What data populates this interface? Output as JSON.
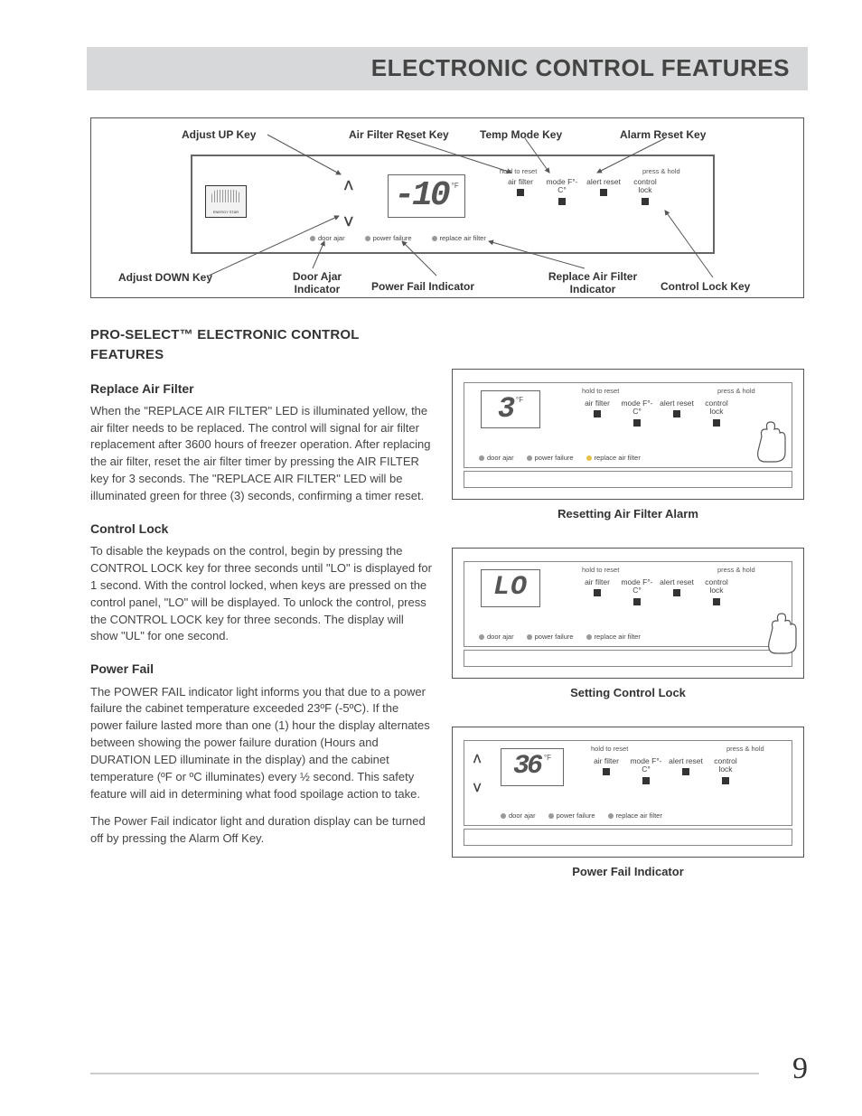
{
  "header": {
    "title": "ELECTRONIC CONTROL FEATURES"
  },
  "top_labels": {
    "adjust_up": "Adjust UP Key",
    "air_filter_reset": "Air Filter Reset Key",
    "temp_mode": "Temp Mode Key",
    "alarm_reset": "Alarm Reset Key",
    "adjust_down": "Adjust DOWN Key",
    "door_ajar": "Door Ajar Indicator",
    "power_fail": "Power Fail Indicator",
    "replace_filter": "Replace Air Filter Indicator",
    "control_lock": "Control Lock Key"
  },
  "panel": {
    "temp_unit": "°F",
    "hold_to_reset": "hold to reset",
    "press_hold": "press & hold",
    "btn_air_filter": "air filter",
    "btn_mode": "mode F°-C°",
    "btn_alert": "alert reset",
    "btn_lock": "control lock",
    "ind_door": "door ajar",
    "ind_power": "power failure",
    "ind_filter": "replace air filter"
  },
  "top_display": "-10",
  "fig1": {
    "display": "3",
    "caption": "Resetting Air Filter Alarm"
  },
  "fig2": {
    "display": "LO",
    "caption": "Setting Control Lock"
  },
  "fig3": {
    "display": "36",
    "caption": "Power Fail Indicator",
    "up": "ᐱ",
    "down": "ᐯ"
  },
  "content": {
    "h2": "PRO-SELECT™ ELECTRONIC CONTROL FEATURES",
    "s1_h": "Replace Air Filter",
    "s1_p": "When the \"REPLACE AIR FILTER\" LED is illuminated yellow, the air filter needs to be replaced.  The control will signal for air filter replacement after 3600 hours of freezer operation.  After replacing the air filter, reset the air filter timer by pressing the AIR FILTER key for 3 seconds.  The  \"REPLACE AIR FILTER\" LED will be illuminated green for three (3) seconds, confirming a timer reset.",
    "s2_h": "Control Lock",
    "s2_p": "To disable the keypads on the control, begin by pressing the CONTROL LOCK key for three seconds until \"LO\" is displayed for 1 second. With the control locked, when keys are pressed on the control panel, \"LO\" will be displayed. To unlock the control, press the CONTROL LOCK key for three seconds. The display will show \"UL\" for one second.",
    "s3_h": "Power Fail",
    "s3_p1": "The POWER FAIL indicator light informs you that due to a power failure the cabinet temperature exceeded 23ºF (-5ºC).  If the power failure lasted more than one (1) hour the display alternates between showing the power failure duration (Hours and DURATION LED illuminate in the display) and the cabinet temperature (ºF or ºC illuminates) every ½ second. This safety feature will aid in determining what food spoilage action to take.",
    "s3_p2": "The Power Fail indicator light and duration display can be turned off by pressing the Alarm Off Key."
  },
  "page_number": "9",
  "chart_data": {
    "type": "table",
    "title": "Electronic control panel callouts",
    "rows": [
      {
        "callout": "Adjust UP Key",
        "position": "top-left",
        "interactable": true
      },
      {
        "callout": "Air Filter Reset Key",
        "position": "top-center",
        "interactable": true
      },
      {
        "callout": "Temp Mode Key",
        "position": "top-center",
        "interactable": true
      },
      {
        "callout": "Alarm Reset Key",
        "position": "top-right",
        "interactable": true
      },
      {
        "callout": "Adjust DOWN Key",
        "position": "bottom-left",
        "interactable": true
      },
      {
        "callout": "Door Ajar Indicator",
        "position": "bottom-center",
        "interactable": false
      },
      {
        "callout": "Power Fail Indicator",
        "position": "bottom-center",
        "interactable": false
      },
      {
        "callout": "Replace Air Filter Indicator",
        "position": "bottom-center",
        "interactable": false
      },
      {
        "callout": "Control Lock Key",
        "position": "bottom-right",
        "interactable": true
      }
    ]
  }
}
